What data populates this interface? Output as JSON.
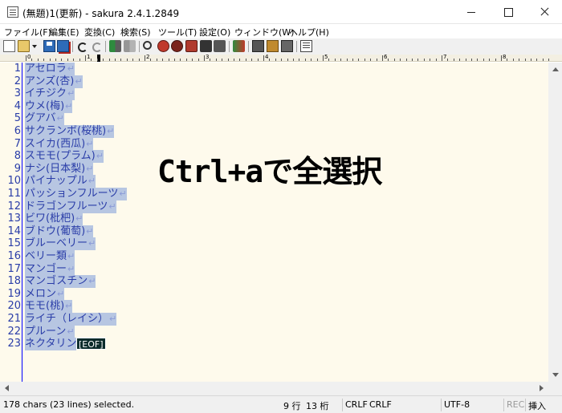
{
  "window": {
    "title": "(無題)1(更新) - sakura 2.4.1.2849"
  },
  "menu": [
    "ファイル(F)",
    "編集(E)",
    "変換(C)",
    "検索(S)",
    "ツール(T)",
    "設定(O)",
    "ウィンドウ(W)",
    "ヘルプ(H)"
  ],
  "toolbar": {
    "icons": [
      "new-file-icon",
      "open-file-icon",
      "dropdown-icon",
      "save-icon",
      "save-all-icon",
      "undo-icon",
      "redo-icon",
      "jump-back-icon",
      "jump-forward-icon",
      "find-icon",
      "find-prev-icon",
      "find-next-icon",
      "replace-icon",
      "grep-icon",
      "grep-replace-icon",
      "compare-icon",
      "outline-icon",
      "output-icon",
      "column-icon",
      "settings-icon"
    ]
  },
  "ruler": {
    "labels": [
      "0",
      "1",
      "2",
      "3",
      "4",
      "5",
      "6",
      "7",
      "8",
      "9"
    ]
  },
  "editor": {
    "lines": [
      {
        "num": "1",
        "text": "アセロラ"
      },
      {
        "num": "2",
        "text": "アンズ(杏)"
      },
      {
        "num": "3",
        "text": "イチジク"
      },
      {
        "num": "4",
        "text": "ウメ(梅)"
      },
      {
        "num": "5",
        "text": "グアバ"
      },
      {
        "num": "6",
        "text": "サクランボ(桜桃)"
      },
      {
        "num": "7",
        "text": "スイカ(西瓜)"
      },
      {
        "num": "8",
        "text": "スモモ(プラム)"
      },
      {
        "num": "9",
        "text": "ナシ(日本梨)"
      },
      {
        "num": "10",
        "text": "パイナップル"
      },
      {
        "num": "11",
        "text": "パッションフルーツ"
      },
      {
        "num": "12",
        "text": "ドラゴンフルーツ"
      },
      {
        "num": "13",
        "text": "ビワ(枇杷)"
      },
      {
        "num": "14",
        "text": "ブドウ(葡萄)"
      },
      {
        "num": "15",
        "text": "ブルーベリー"
      },
      {
        "num": "16",
        "text": "ベリー類"
      },
      {
        "num": "17",
        "text": "マンゴー"
      },
      {
        "num": "18",
        "text": "マンゴスチン"
      },
      {
        "num": "19",
        "text": "メロン"
      },
      {
        "num": "20",
        "text": "モモ(桃)"
      },
      {
        "num": "21",
        "text": "ライチ（レイシ）"
      },
      {
        "num": "22",
        "text": "プルーン"
      },
      {
        "num": "23",
        "text": "ネクタリン"
      }
    ],
    "eol_mark": "↵",
    "eof_mark": "[EOF]",
    "caption": "Ctrl+aで全選択",
    "colors": {
      "background": "#fefaec",
      "selection": "#b7c6e2",
      "text": "#2a3da8"
    }
  },
  "status": {
    "message": "178 chars (23 lines) selected.",
    "line": "9 行",
    "column": "13 桁",
    "eol_input": "CRLF",
    "eol_type": "CRLF",
    "encoding": "UTF-8",
    "rec": "REC",
    "mode": "挿入"
  }
}
